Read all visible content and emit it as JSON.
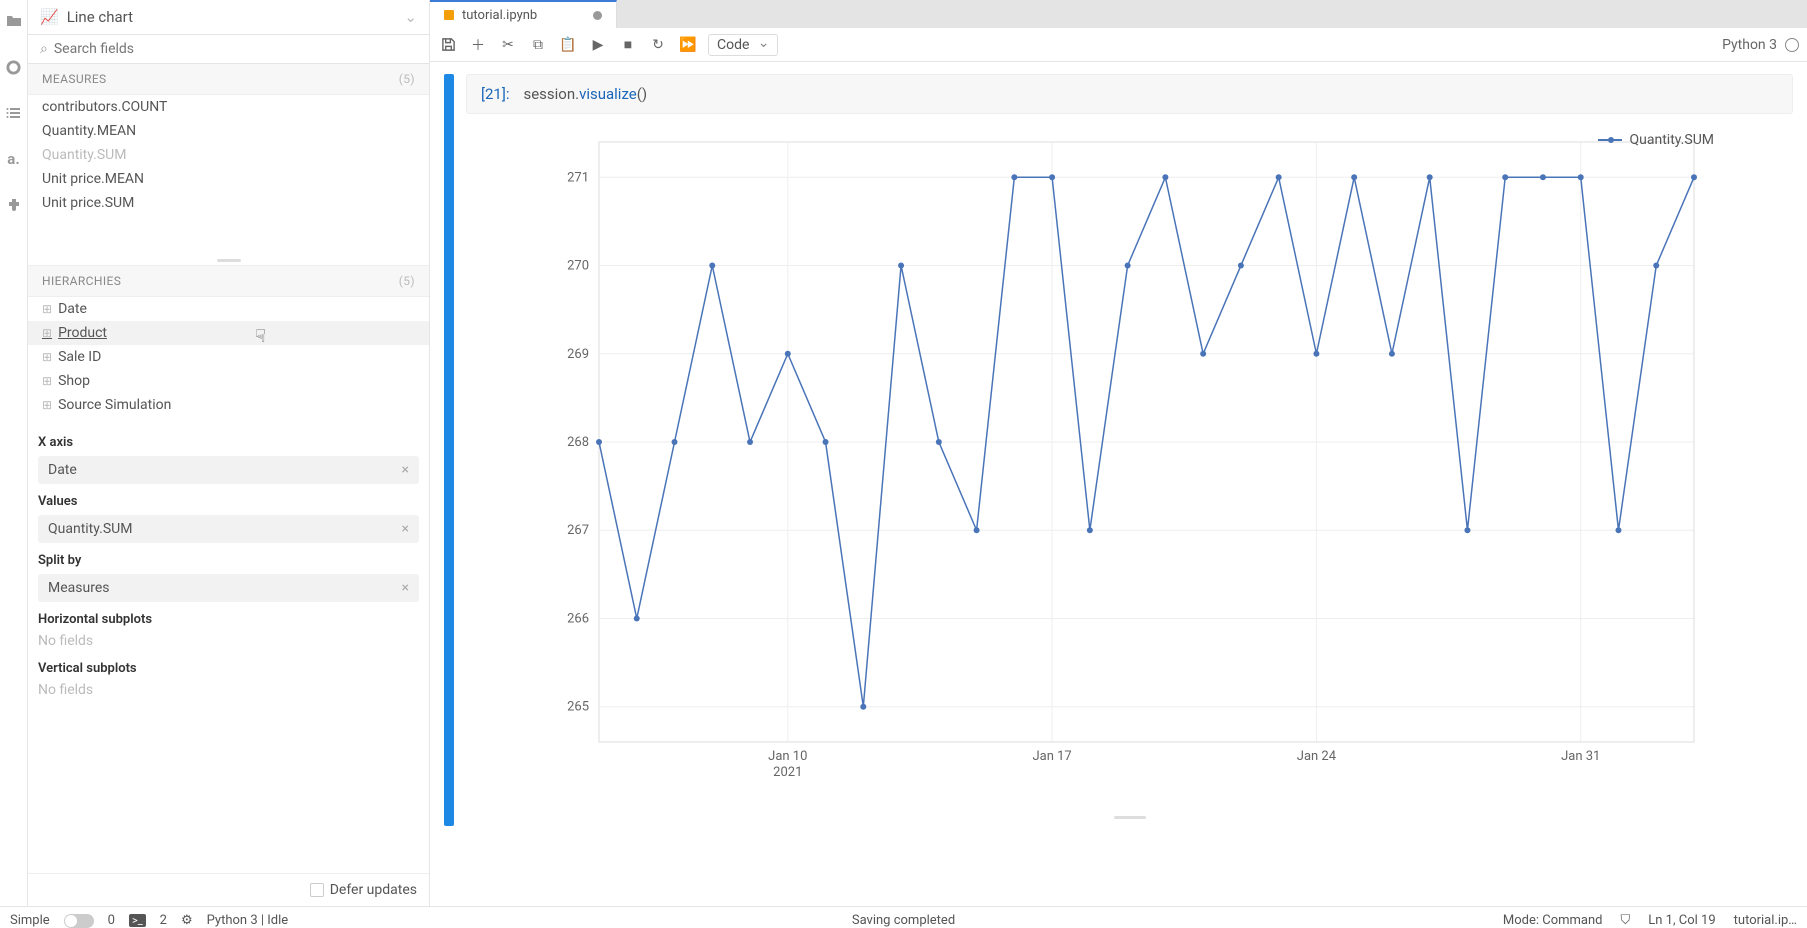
{
  "rail_icons": [
    "folder",
    "circle",
    "list",
    "aleph",
    "puzzle"
  ],
  "chart_type": "Line chart",
  "search_placeholder": "Search fields",
  "measures_header": "MEASURES",
  "measures_count": "(5)",
  "measures": [
    {
      "label": "contributors.COUNT",
      "dim": false
    },
    {
      "label": "Quantity.MEAN",
      "dim": false
    },
    {
      "label": "Quantity.SUM",
      "dim": true
    },
    {
      "label": "Unit price.MEAN",
      "dim": false
    },
    {
      "label": "Unit price.SUM",
      "dim": false
    }
  ],
  "hier_header": "HIERARCHIES",
  "hier_count": "(5)",
  "hierarchies": [
    "Date",
    "Product",
    "Sale ID",
    "Shop",
    "Source Simulation"
  ],
  "hover_index": 1,
  "cfg": {
    "xaxis_label": "X axis",
    "xaxis_value": "Date",
    "values_label": "Values",
    "values_value": "Quantity.SUM",
    "split_label": "Split by",
    "split_value": "Measures",
    "hsub_label": "Horizontal subplots",
    "hsub_ph": "No fields",
    "vsub_label": "Vertical subplots",
    "vsub_ph": "No fields"
  },
  "defer_label": "Defer updates",
  "tab_name": "tutorial.ipynb",
  "cell_type": "Code",
  "kernel_name": "Python 3",
  "cell_prompt": "[21]:",
  "code_tokens": {
    "obj": "session.",
    "fn": "visualize",
    "tail": "()"
  },
  "legend_label": "Quantity.SUM",
  "status": {
    "simple": "Simple",
    "zero": "0",
    "two": "2",
    "py": "Python 3 | Idle",
    "saving": "Saving completed",
    "mode": "Mode: Command",
    "cursor": "Ln 1, Col 19",
    "file": "tutorial.ip…"
  },
  "chart_data": {
    "type": "line",
    "legend": "Quantity.SUM",
    "xlabel": "2021",
    "yticks": [
      265,
      266,
      267,
      268,
      269,
      270,
      271
    ],
    "xticks": [
      "Jan 10",
      "Jan 17",
      "Jan 24",
      "Jan 31"
    ],
    "ylim": [
      264.6,
      271.4
    ],
    "series": [
      {
        "name": "Quantity.SUM",
        "x_start": "2021-01-05",
        "points": [
          268,
          266,
          268,
          270,
          268,
          269,
          268,
          265,
          270,
          268,
          267,
          271,
          271,
          267,
          270,
          271,
          269,
          270,
          271,
          269,
          271,
          269,
          271,
          267,
          271,
          271,
          271,
          267,
          270,
          271
        ]
      }
    ]
  }
}
